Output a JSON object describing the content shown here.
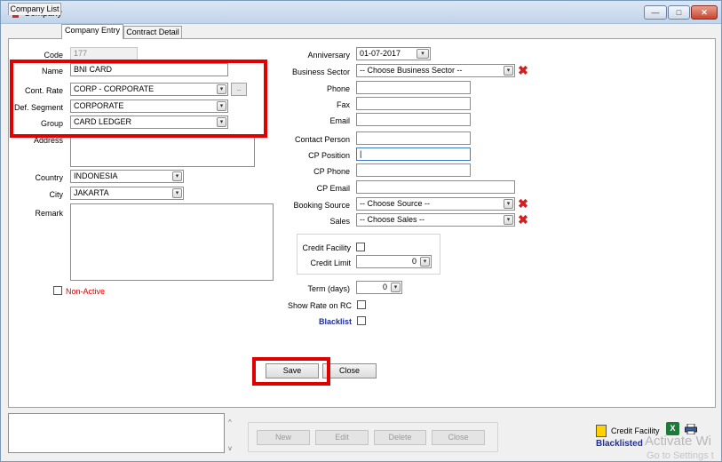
{
  "window": {
    "title": "Company",
    "min_glyph": "—",
    "max_glyph": "□",
    "close_glyph": "✕"
  },
  "tabs": [
    {
      "label": "Company List"
    },
    {
      "label": "Company Entry"
    },
    {
      "label": "Contract Detail"
    }
  ],
  "left_form": {
    "code": {
      "label": "Code",
      "value": "177"
    },
    "name": {
      "label": "Name",
      "value": "BNI CARD"
    },
    "cont_rate": {
      "label": "Cont. Rate",
      "value": "CORP - CORPORATE",
      "btn": ".."
    },
    "def_segment": {
      "label": "Def. Segment",
      "value": "CORPORATE"
    },
    "group": {
      "label": "Group",
      "value": "CARD LEDGER"
    },
    "address": {
      "label": "Address"
    },
    "country": {
      "label": "Country",
      "value": "INDONESIA"
    },
    "city": {
      "label": "City",
      "value": "JAKARTA"
    },
    "remark": {
      "label": "Remark"
    },
    "non_active": {
      "label": "Non-Active"
    }
  },
  "right_form": {
    "anniversary": {
      "label": "Anniversary",
      "value": "01-07-2017"
    },
    "business_sector": {
      "label": "Business Sector",
      "value": "-- Choose Business Sector --"
    },
    "phone": {
      "label": "Phone",
      "value": ""
    },
    "fax": {
      "label": "Fax",
      "value": ""
    },
    "email": {
      "label": "Email",
      "value": ""
    },
    "contact_person": {
      "label": "Contact Person",
      "value": ""
    },
    "cp_position": {
      "label": "CP Position",
      "value": "|"
    },
    "cp_phone": {
      "label": "CP Phone",
      "value": ""
    },
    "cp_email": {
      "label": "CP Email",
      "value": ""
    },
    "booking_source": {
      "label": "Booking Source",
      "value": "-- Choose Source --"
    },
    "sales": {
      "label": "Sales",
      "value": "-- Choose Sales --"
    },
    "credit_facility": {
      "label": "Credit Facility"
    },
    "credit_limit": {
      "label": "Credit Limit",
      "value": "0"
    },
    "term_days": {
      "label": "Term (days)",
      "value": "0"
    },
    "show_rate_on_rc": {
      "label": "Show Rate on RC"
    },
    "blacklist": {
      "label": "Blacklist"
    }
  },
  "actions": {
    "save": "Save",
    "close": "Close"
  },
  "bottom_buttons": {
    "new": "New",
    "edit": "Edit",
    "delete": "Delete",
    "close": "Close"
  },
  "legend": {
    "credit_facility": "Credit Facility",
    "blacklisted": "Blacklisted",
    "credit_color": "#ffd200",
    "blacklisted_color": "#1e2e9e"
  },
  "watermark": {
    "line1": "Activate Wi",
    "line2": "Go to Settings t"
  },
  "icons": {
    "dropdown": "▾",
    "remove": "✖",
    "scroll_up": "^",
    "scroll_down": "v",
    "excel": "X"
  },
  "highlight_color": "#e00000"
}
